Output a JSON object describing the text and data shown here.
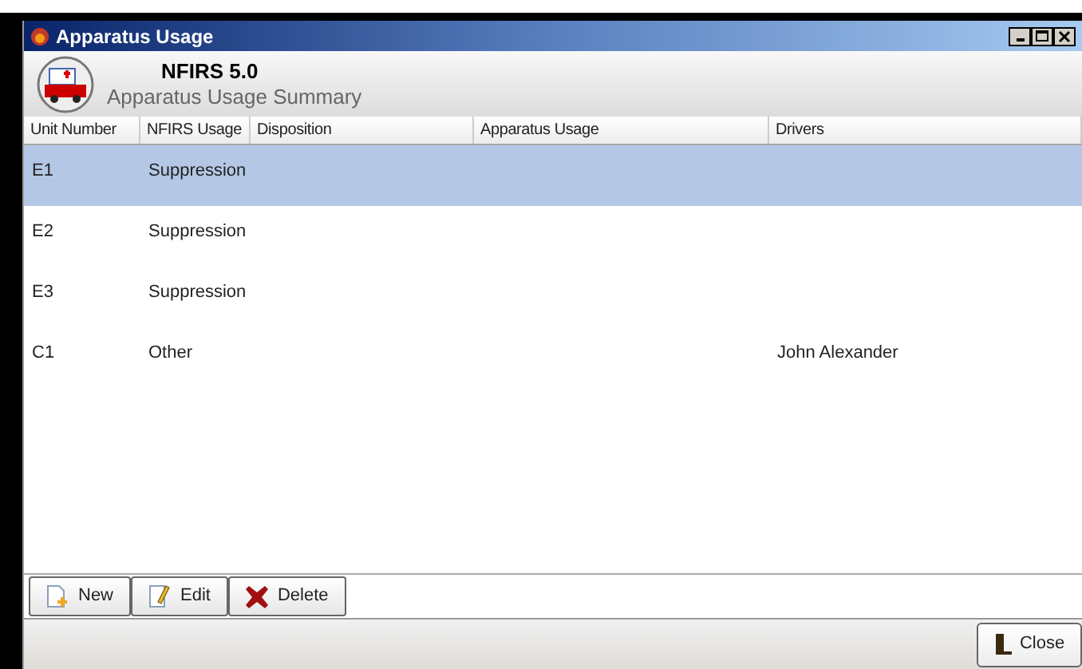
{
  "window": {
    "title": "Apparatus Usage"
  },
  "header": {
    "title": "NFIRS 5.0",
    "subtitle": "Apparatus Usage Summary"
  },
  "table": {
    "columns": [
      "Unit Number",
      "NFIRS Usage",
      "Disposition",
      "Apparatus Usage",
      "Drivers"
    ],
    "rows": [
      {
        "cells": [
          "E1",
          "Suppression",
          "",
          "",
          ""
        ],
        "selected": true
      },
      {
        "cells": [
          "E2",
          "Suppression",
          "",
          "",
          ""
        ],
        "selected": false
      },
      {
        "cells": [
          "E3",
          "Suppression",
          "",
          "",
          ""
        ],
        "selected": false
      },
      {
        "cells": [
          "C1",
          "Other",
          "",
          "",
          "John Alexander"
        ],
        "selected": false
      }
    ]
  },
  "toolbar": [
    {
      "kind": "new",
      "label": "New"
    },
    {
      "kind": "edit",
      "label": "Edit"
    },
    {
      "kind": "delete",
      "label": "Delete"
    }
  ],
  "status_bar": {
    "close_button": "Close"
  }
}
